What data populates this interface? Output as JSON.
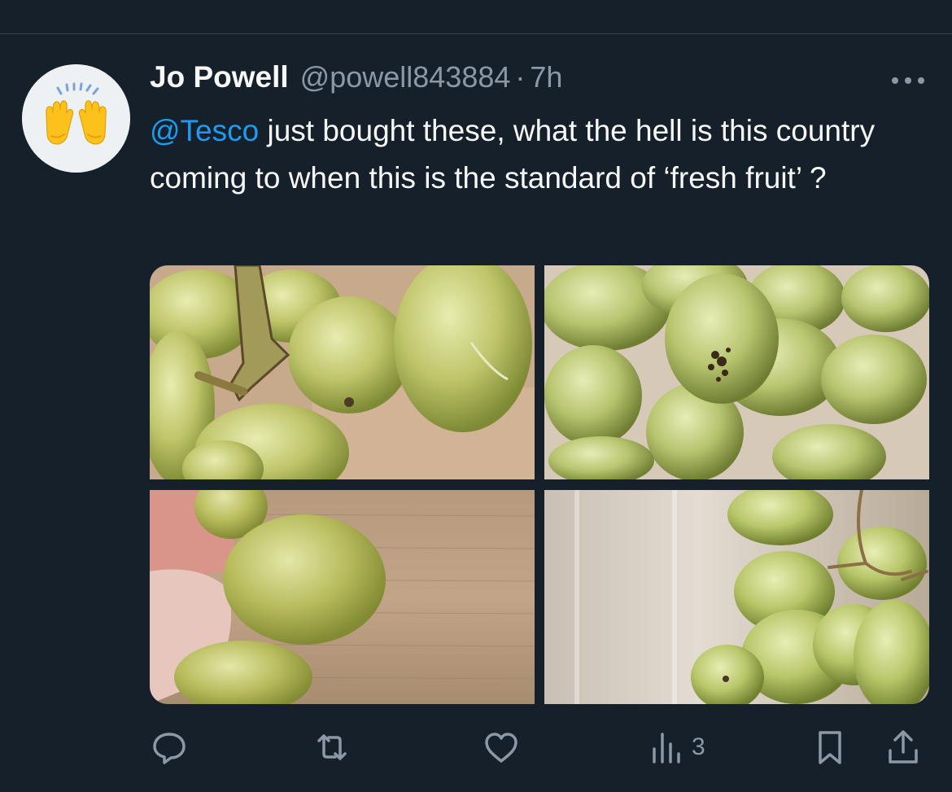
{
  "tweet": {
    "author_name": "Jo Powell",
    "handle": "@powell843884",
    "separator": "·",
    "time": "7h",
    "mention": "@Tesco",
    "text_after_mention": " just bought these, what the hell is this country coming to when this is the standard of ‘fresh fruit’ ?",
    "avatar_icon": "raising-hands-emoji"
  },
  "actions": {
    "reply_icon": "reply-icon",
    "retweet_icon": "retweet-icon",
    "like_icon": "heart-icon",
    "views_icon": "views-icon",
    "views_count": "3",
    "bookmark_icon": "bookmark-icon",
    "share_icon": "share-icon"
  },
  "colors": {
    "background": "#15202b",
    "text": "#f7f9f9",
    "secondary": "#8b98a5",
    "link": "#1d9bf0",
    "divider": "#38444d"
  }
}
